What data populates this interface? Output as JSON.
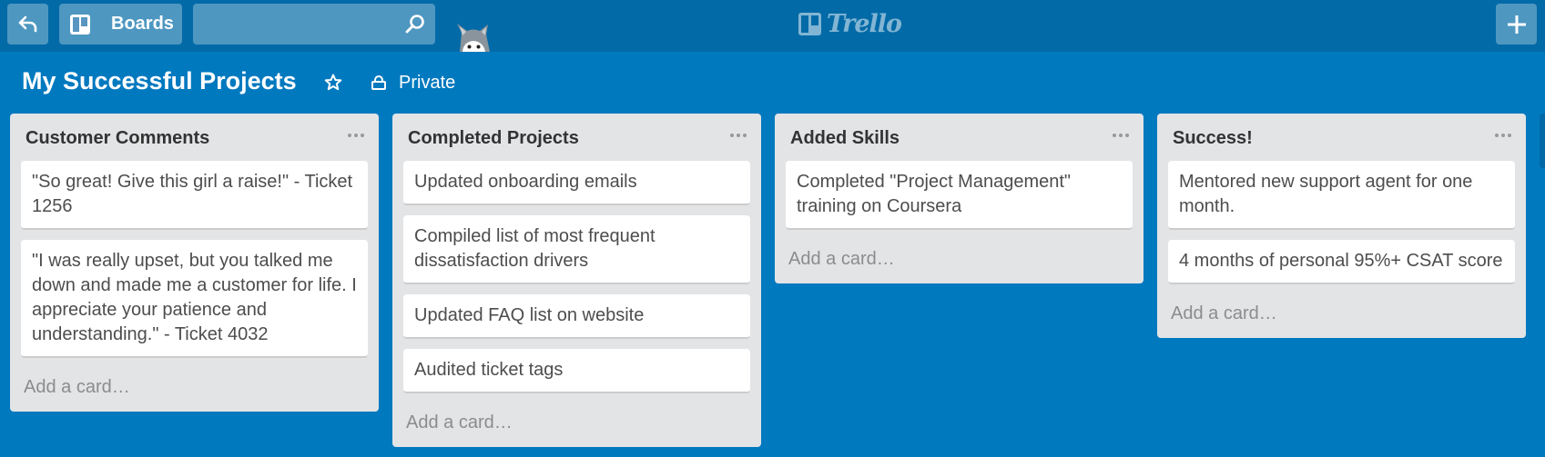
{
  "header": {
    "back_icon": "back-arrow-icon",
    "boards_label": "Boards",
    "boards_icon": "trello-board-icon",
    "search_value": "",
    "search_icon": "search-icon",
    "logo_text": "Trello",
    "add_icon": "plus-icon",
    "mascot": "husky-mascot-icon"
  },
  "board": {
    "title": "My Successful Projects",
    "star_icon": "star-icon",
    "privacy_icon": "lock-icon",
    "privacy_label": "Private"
  },
  "lists": [
    {
      "title": "Customer Comments",
      "cards": [
        "\"So great! Give this girl a raise!\" - Ticket 1256",
        "\"I was really upset, but you talked me down and made me a customer for life. I appreciate your patience and understanding.\" - Ticket 4032"
      ],
      "add_card_label": "Add a card…"
    },
    {
      "title": "Completed Projects",
      "cards": [
        "Updated onboarding emails",
        "Compiled list of most frequent dissatisfaction drivers",
        "Updated FAQ list on website",
        "Audited ticket tags"
      ],
      "add_card_label": "Add a card…"
    },
    {
      "title": "Added Skills",
      "cards": [
        "Completed \"Project Management\" training on Coursera"
      ],
      "add_card_label": "Add a card…"
    },
    {
      "title": "Success!",
      "cards": [
        "Mentored new support agent for one month.",
        "4 months of personal 95%+ CSAT score"
      ],
      "add_card_label": "Add a card…"
    }
  ],
  "colors": {
    "header_bg": "#026aa7",
    "board_bg": "#0079bf",
    "list_bg": "#e2e4e6",
    "card_bg": "#ffffff"
  }
}
